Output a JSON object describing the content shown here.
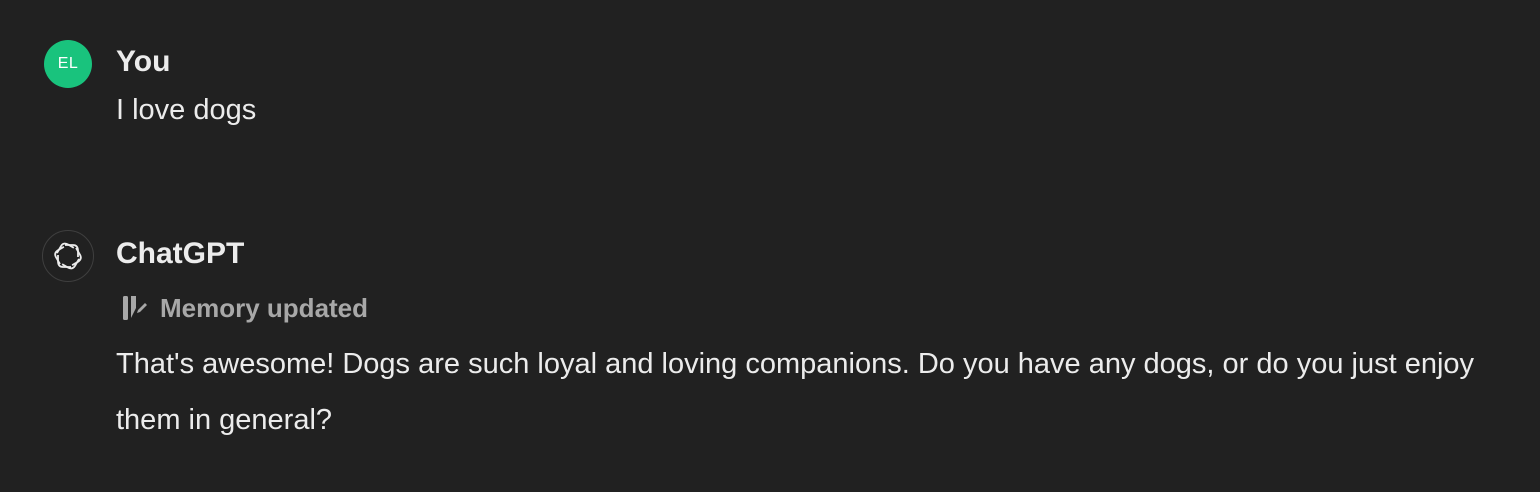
{
  "conversation": {
    "user_message": {
      "avatar_initials": "EL",
      "author": "You",
      "text": "I love dogs",
      "avatar_color": "#19c37d"
    },
    "assistant_message": {
      "avatar_icon": "openai-logo-icon",
      "author": "ChatGPT",
      "memory_status": {
        "icon": "memory-edit-icon",
        "label": "Memory updated"
      },
      "text": "That's awesome! Dogs are such loyal and loving companions. Do you have any dogs, or do you just enjoy them in general?"
    }
  },
  "colors": {
    "background": "#212121",
    "text": "#ececec",
    "muted": "#a8a8a8"
  }
}
